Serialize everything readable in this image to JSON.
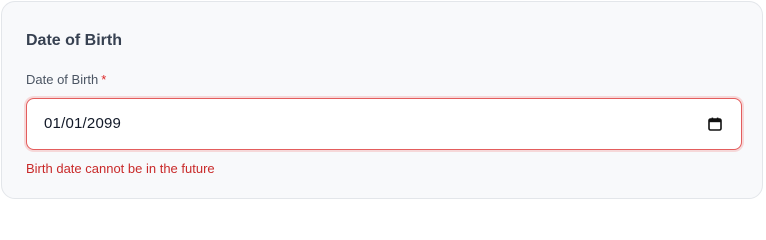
{
  "section": {
    "title": "Date of Birth"
  },
  "field": {
    "label": "Date of Birth",
    "required_marker": "*",
    "value": "01/01/2099",
    "icon": "calendar-icon",
    "error": "Birth date cannot be in the future"
  },
  "colors": {
    "error": "#c92a2a",
    "required": "#dc2626",
    "input_border_error": "#e35d5d"
  }
}
